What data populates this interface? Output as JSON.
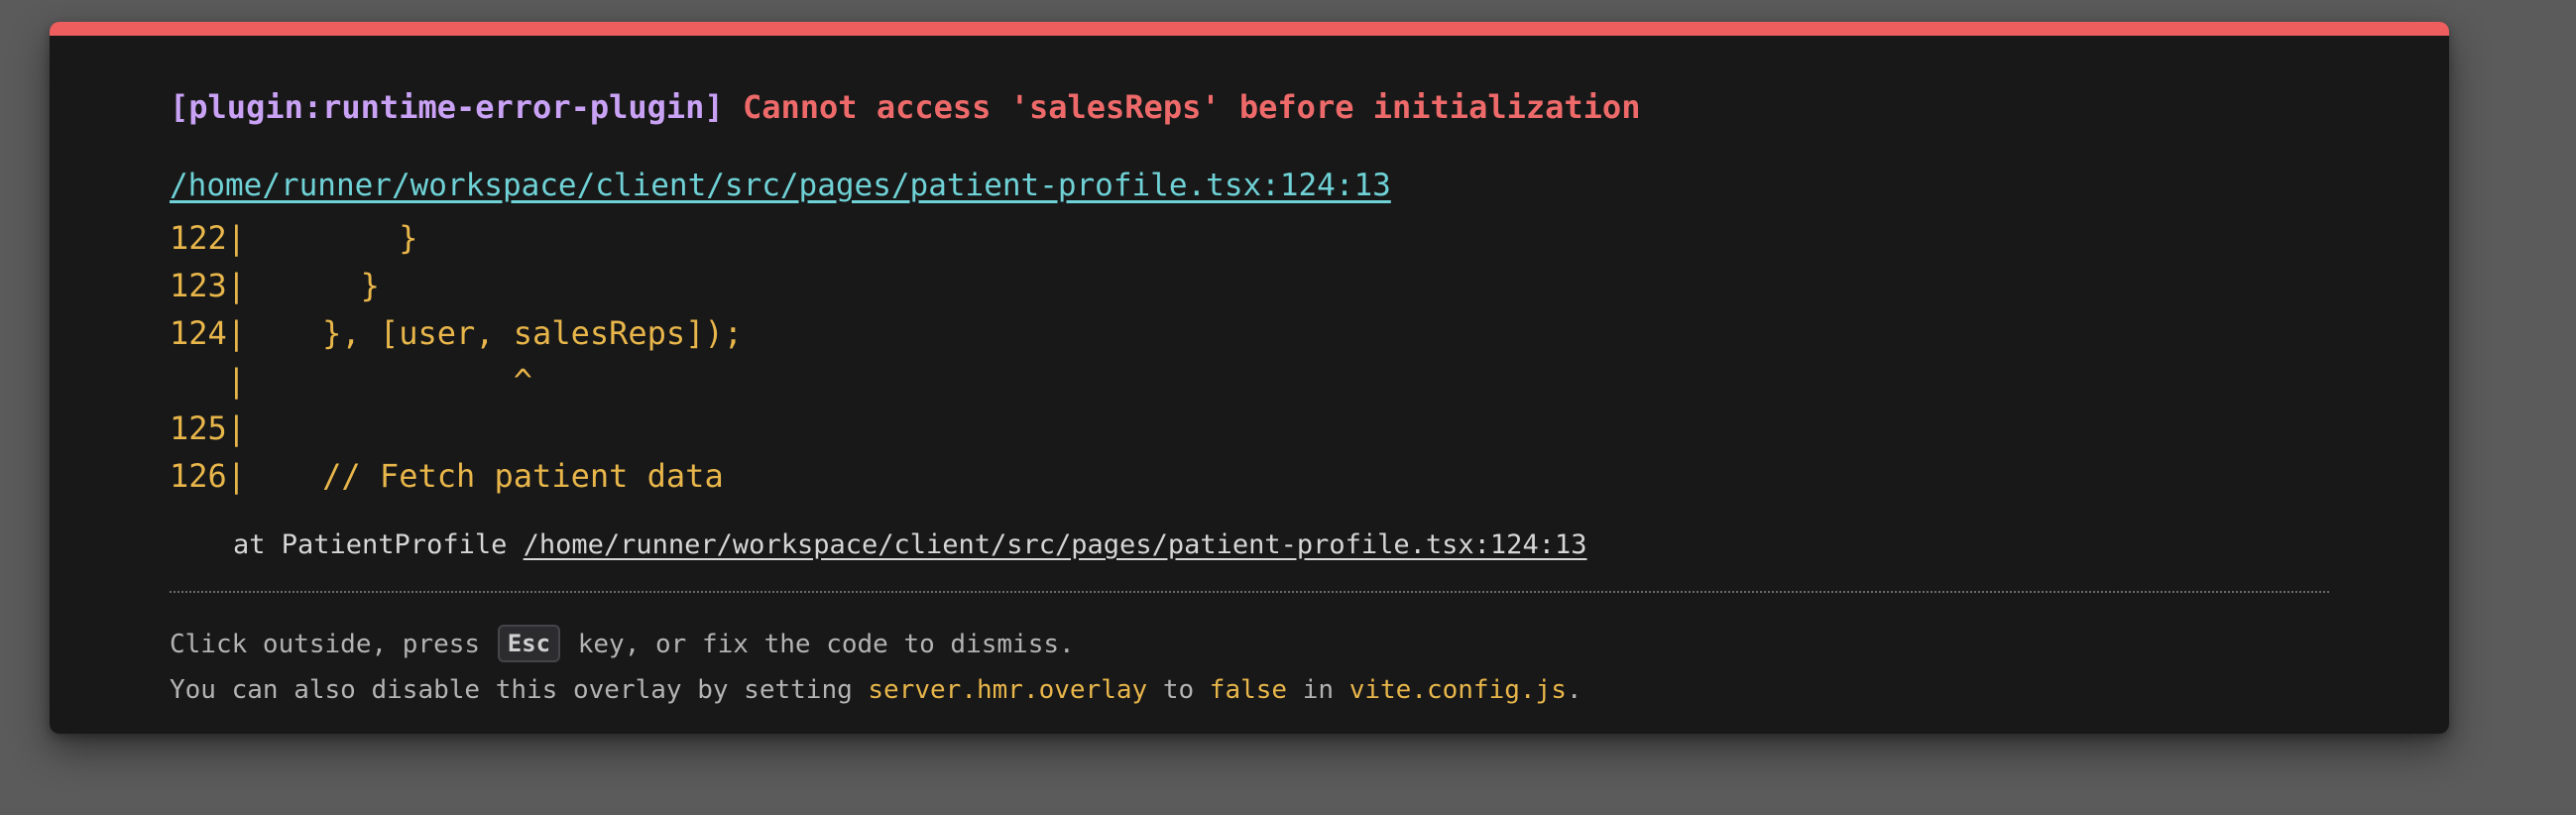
{
  "overlay": {
    "accent_color": "#ee5e5e",
    "background_color": "#181818",
    "plugin": "[plugin:runtime-error-plugin]",
    "message": "Cannot access 'salesReps' before initialization",
    "file": "/home/runner/workspace/client/src/pages/patient-profile.tsx:124:13",
    "frame": [
      "122|        }",
      "123|      }",
      "124|    }, [user, salesReps]);",
      "   |              ^",
      "125|",
      "126|    // Fetch patient data"
    ],
    "stack": {
      "prefix": "at PatientProfile ",
      "link": "/home/runner/workspace/client/src/pages/patient-profile.tsx:124:13"
    },
    "tip": {
      "line1_before": "Click outside, press ",
      "key": "Esc",
      "line1_after": " key, or fix the code to dismiss.",
      "line2_a": "You can also disable this overlay by setting ",
      "line2_code1": "server.hmr.overlay",
      "line2_b": " to ",
      "line2_code2": "false",
      "line2_c": " in ",
      "line2_code3": "vite.config.js",
      "line2_d": "."
    }
  }
}
